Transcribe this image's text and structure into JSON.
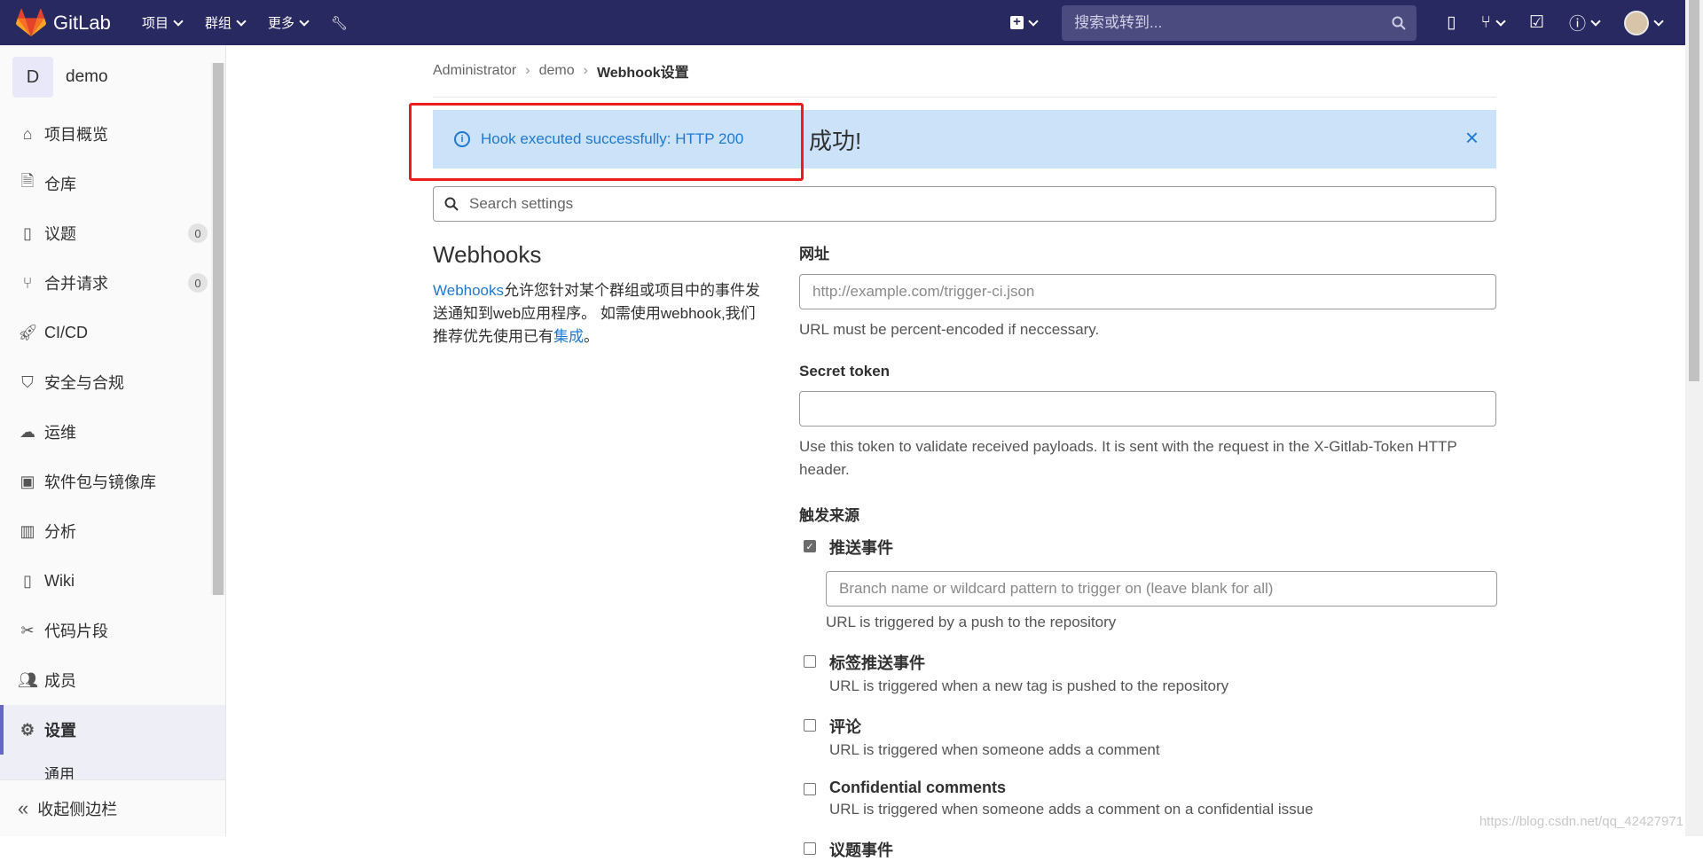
{
  "navbar": {
    "brand": "GitLab",
    "menu": [
      {
        "label": "项目"
      },
      {
        "label": "群组"
      },
      {
        "label": "更多"
      }
    ],
    "search_placeholder": "搜索或转到..."
  },
  "sidebar": {
    "project_initial": "D",
    "project_name": "demo",
    "items": [
      {
        "label": "项目概览",
        "icon": "home-icon"
      },
      {
        "label": "仓库",
        "icon": "document-icon"
      },
      {
        "label": "议题",
        "icon": "issues-icon",
        "badge": "0"
      },
      {
        "label": "合并请求",
        "icon": "merge-request-icon",
        "badge": "0"
      },
      {
        "label": "CI/CD",
        "icon": "rocket-icon"
      },
      {
        "label": "安全与合规",
        "icon": "shield-icon"
      },
      {
        "label": "运维",
        "icon": "cloud-icon"
      },
      {
        "label": "软件包与镜像库",
        "icon": "package-icon"
      },
      {
        "label": "分析",
        "icon": "chart-icon"
      },
      {
        "label": "Wiki",
        "icon": "book-icon"
      },
      {
        "label": "代码片段",
        "icon": "scissors-icon"
      },
      {
        "label": "成员",
        "icon": "users-icon"
      },
      {
        "label": "设置",
        "icon": "gear-icon"
      }
    ],
    "sub_item": "通用",
    "collapse_label": "收起侧边栏"
  },
  "breadcrumb": {
    "items": [
      "Administrator",
      "demo",
      "Webhook设置"
    ]
  },
  "flash": {
    "message": "Hook executed successfully: HTTP 200",
    "success_text": "成功!",
    "close": "×"
  },
  "settings_search": {
    "placeholder": "Search settings"
  },
  "webhooks": {
    "title": "Webhooks",
    "desc_link": "Webhooks",
    "desc_text_1": "允许您针对某个群组或项目中的事件发送通知到web应用程序。 如需使用webhook,我们推荐优先使用已有",
    "desc_link_2": "集成",
    "desc_text_2": "。"
  },
  "form": {
    "url_label": "网址",
    "url_placeholder": "http://example.com/trigger-ci.json",
    "url_help": "URL must be percent-encoded if neccessary.",
    "token_label": "Secret token",
    "token_value": "",
    "token_help": "Use this token to validate received payloads. It is sent with the request in the X-Gitlab-Token HTTP header.",
    "trigger_label": "触发来源",
    "push_title": "推送事件",
    "push_checked": true,
    "branch_placeholder": "Branch name or wildcard pattern to trigger on (leave blank for all)",
    "push_help": "URL is triggered by a push to the repository",
    "tag_title": "标签推送事件",
    "tag_help": "URL is triggered when a new tag is pushed to the repository",
    "comment_title": "评论",
    "comment_help": "URL is triggered when someone adds a comment",
    "conf_title": "Confidential comments",
    "conf_help": "URL is triggered when someone adds a comment on a confidential issue",
    "issue_title": "议题事件"
  },
  "watermark": "https://blog.csdn.net/qq_42427971"
}
